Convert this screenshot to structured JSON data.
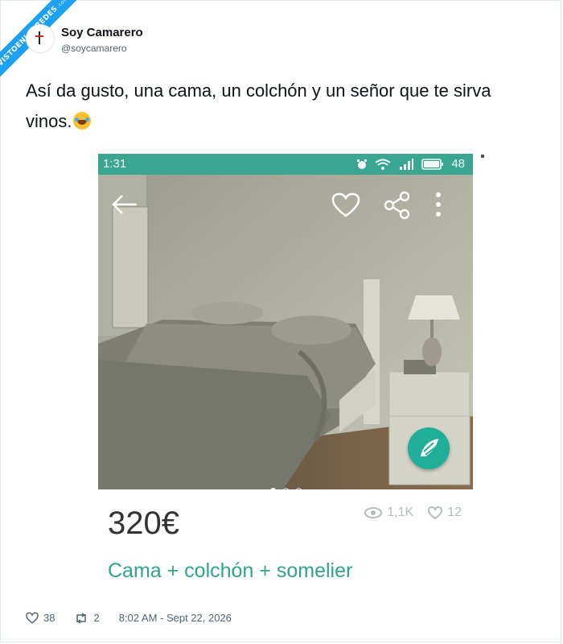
{
  "watermark": {
    "text": "VISTOENLASREDES",
    "sub": ".com"
  },
  "author": {
    "name": "Soy Camarero",
    "handle": "@soycamarero"
  },
  "tweet": {
    "text": "Así da gusto, una cama, un colchón y un señor que te sirva vinos."
  },
  "emoji": "rolling-on-floor-laughing",
  "screenshot": {
    "status_time": "1:31",
    "battery": "48",
    "price": "320€",
    "views": "1,1K",
    "likes": "12",
    "title": "Cama + colchón + somelier",
    "carousel_pages": 3,
    "carousel_active": 1,
    "accent_color": "#3aa68f"
  },
  "footer": {
    "likes": "38",
    "retweets": "2",
    "timestamp": "8:02 AM - Sept 22, 2026"
  },
  "colors": {
    "ribbon": "#1da1f2",
    "fab": "#1fae97",
    "title": "#2ea58e"
  }
}
